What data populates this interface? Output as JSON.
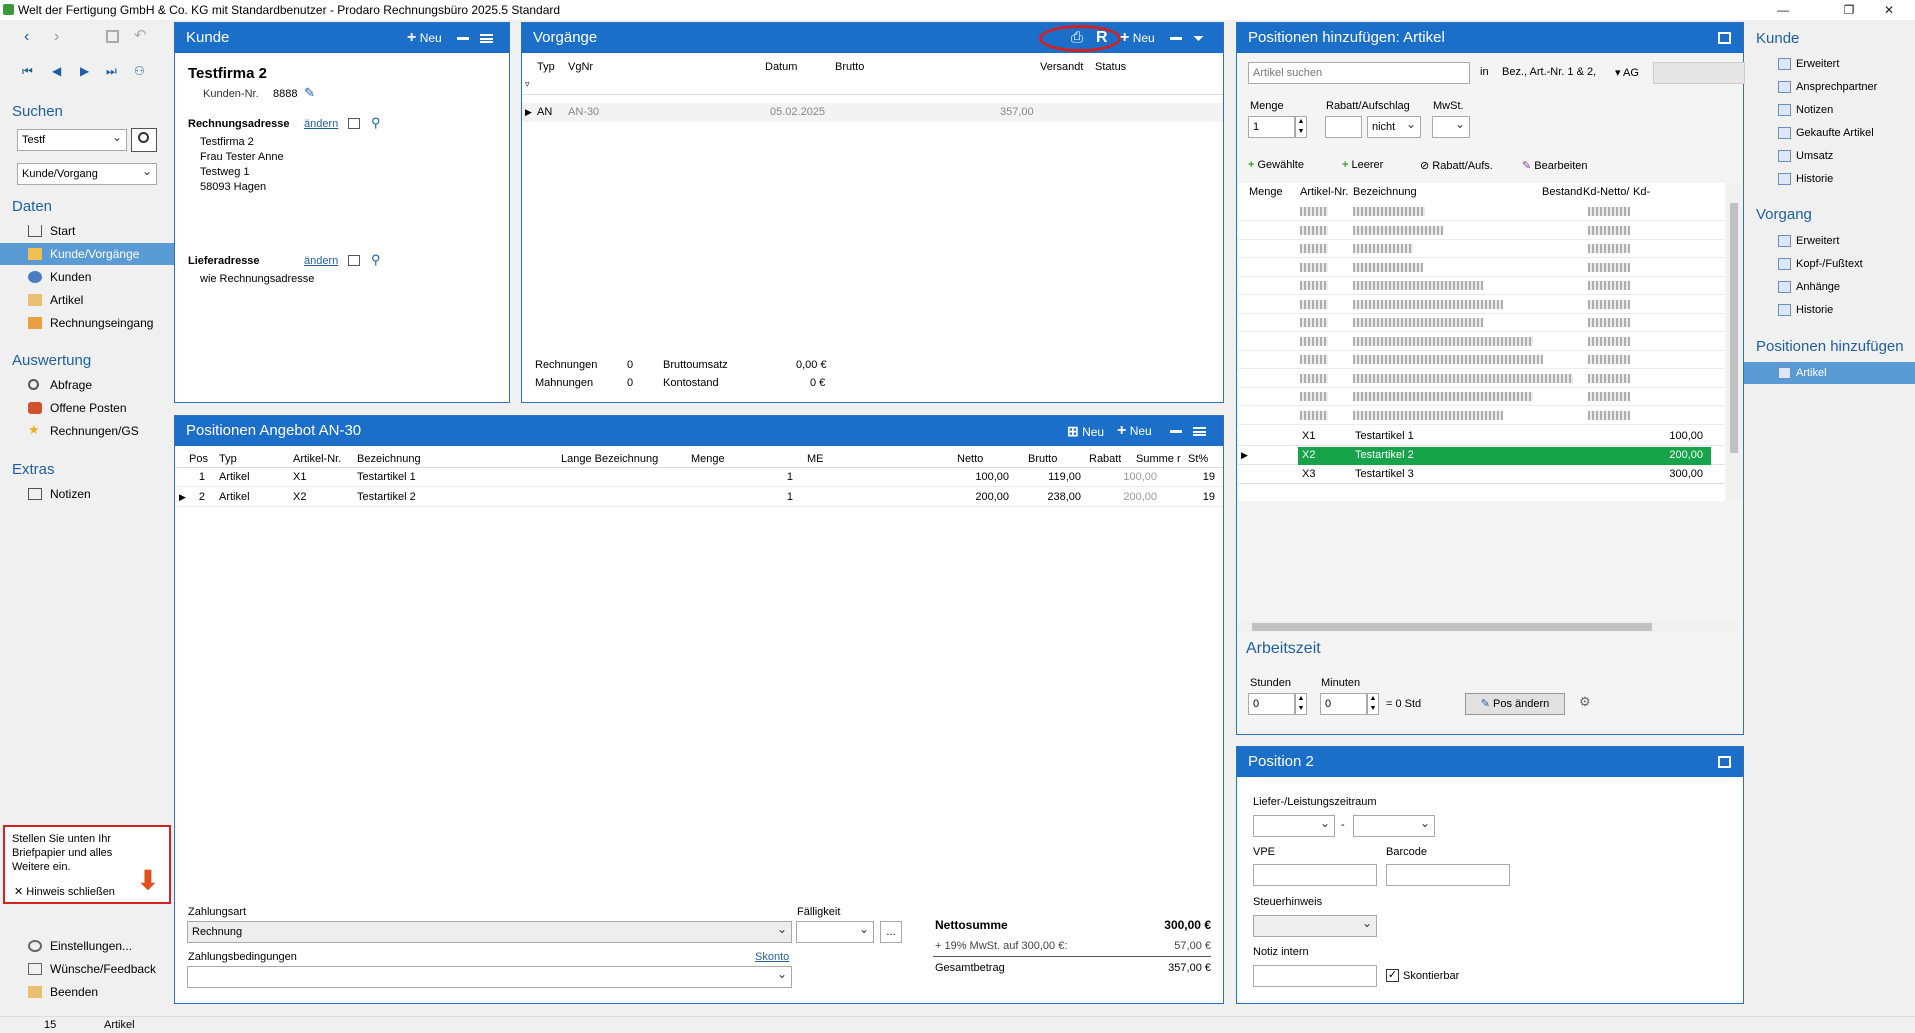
{
  "window": {
    "title": "Welt der Fertigung GmbH & Co. KG mit Standardbenutzer  -  Prodaro Rechnungsbüro 2025.5 Standard"
  },
  "left": {
    "suchen_label": "Suchen",
    "search_value": "Testf",
    "scope_value": "Kunde/Vorgang",
    "daten_label": "Daten",
    "daten": [
      "Start",
      "Kunde/Vorgänge",
      "Kunden",
      "Artikel",
      "Rechnungseingang"
    ],
    "auswertung_label": "Auswertung",
    "auswertung": [
      "Abfrage",
      "Offene Posten",
      "Rechnungen/GS"
    ],
    "extras_label": "Extras",
    "extras": [
      "Notizen"
    ],
    "hint_text": "Stellen Sie unten Ihr Briefpapier und alles Weitere ein.",
    "hint_close": "Hinweis schließen",
    "bottom": [
      "Einstellungen...",
      "Wünsche/Feedback",
      "Beenden"
    ]
  },
  "kunde": {
    "title": "Kunde",
    "neu": "Neu",
    "name": "Testfirma 2",
    "nr_label": "Kunden-Nr.",
    "nr": "8888",
    "rechnungsadresse_label": "Rechnungsadresse",
    "aendern": "ändern",
    "address": [
      "Testfirma 2",
      "Frau Tester Anne",
      "Testweg 1",
      "58093 Hagen"
    ],
    "lieferadresse_label": "Lieferadresse",
    "liefer_value": "wie Rechnungsadresse"
  },
  "vorgaenge": {
    "title": "Vorgänge",
    "r_label": "R",
    "neu": "Neu",
    "columns": [
      "Typ",
      "VgNr",
      "Datum",
      "Brutto",
      "Versandt",
      "Status"
    ],
    "rows": [
      {
        "typ": "AN",
        "nr": "AN-30",
        "datum": "05.02.2025",
        "brutto": "357,00"
      }
    ],
    "rechnungen_label": "Rechnungen",
    "rechnungen": "0",
    "mahnungen_label": "Mahnungen",
    "mahnungen": "0",
    "bruttoumsatz_label": "Bruttoumsatz",
    "bruttoumsatz": "0,00 €",
    "kontostand_label": "Kontostand",
    "kontostand": "0 €"
  },
  "positionen": {
    "title": "Positionen Angebot AN-30",
    "neu1": "Neu",
    "neu2": "Neu",
    "columns": [
      "Pos",
      "Typ",
      "Artikel-Nr.",
      "Bezeichnung",
      "Lange Bezeichnung",
      "Menge",
      "ME",
      "Netto",
      "Brutto",
      "Rabatt",
      "Summe r",
      "St%"
    ],
    "rows": [
      {
        "pos": "1",
        "typ": "Artikel",
        "nr": "X1",
        "bez": "Testartikel 1",
        "menge": "1",
        "netto": "100,00",
        "brutto": "119,00",
        "summe": "100,00",
        "st": "19"
      },
      {
        "pos": "2",
        "typ": "Artikel",
        "nr": "X2",
        "bez": "Testartikel 2",
        "menge": "1",
        "netto": "200,00",
        "brutto": "238,00",
        "summe": "200,00",
        "st": "19"
      }
    ],
    "zahlungsart_label": "Zahlungsart",
    "zahlungsart": "Rechnung",
    "faelligkeit_label": "Fälligkeit",
    "zahlungsbedingungen_label": "Zahlungsbedingungen",
    "skonto": "Skonto",
    "nettosumme_label": "Nettosumme",
    "nettosumme": "300,00  €",
    "mwst_label": "+ 19% MwSt. auf 300,00 €:",
    "mwst": "57,00  €",
    "gesamt_label": "Gesamtbetrag",
    "gesamt": "357,00  €"
  },
  "artikel": {
    "title": "Positionen hinzufügen: Artikel",
    "search_placeholder": "Artikel suchen",
    "in_label": "in",
    "in_value": "Bez., Art.-Nr. 1 & 2,",
    "ag": "AG",
    "menge_label": "Menge",
    "menge": "1",
    "rabatt_label": "Rabatt/Aufschlag",
    "rabatt_mode": "nicht",
    "mwst_label": "MwSt.",
    "actions": [
      "Gewählte",
      "Leerer",
      "Rabatt/Aufs.",
      "Bearbeiten"
    ],
    "columns": [
      "Menge",
      "Artikel-Nr.",
      "Bezeichnung",
      "Bestand",
      "Kd-Netto/",
      "Kd-"
    ],
    "rows": [
      {
        "nr": "X1",
        "bez": "Testartikel 1",
        "netto": "100,00"
      },
      {
        "nr": "X2",
        "bez": "Testartikel 2",
        "netto": "200,00"
      },
      {
        "nr": "X3",
        "bez": "Testartikel 3",
        "netto": "300,00"
      }
    ],
    "arbeitszeit_label": "Arbeitszeit",
    "stunden_label": "Stunden",
    "stunden": "0",
    "minuten_label": "Minuten",
    "minuten": "0",
    "std_text": "= 0 Std",
    "pos_aendern": "Pos ändern"
  },
  "position2": {
    "title": "Position 2",
    "liefer_label": "Liefer-/Leistungszeitraum",
    "dash": "-",
    "vpe_label": "VPE",
    "barcode_label": "Barcode",
    "steuer_label": "Steuerhinweis",
    "notiz_label": "Notiz intern",
    "skontierbar": "Skontierbar"
  },
  "right": {
    "kunde_label": "Kunde",
    "kunde": [
      "Erweitert",
      "Ansprechpartner",
      "Notizen",
      "Gekaufte Artikel",
      "Umsatz",
      "Historie"
    ],
    "vorgang_label": "Vorgang",
    "vorgang": [
      "Erweitert",
      "Kopf-/Fußtext",
      "Anhänge",
      "Historie"
    ],
    "pos_label": "Positionen hinzufügen",
    "pos": [
      "Artikel"
    ]
  },
  "status": {
    "count": "15",
    "context": "Artikel"
  },
  "colors": {
    "header": "#1b6fc9",
    "highlight": "#16a34a",
    "accent": "#1f5f9f",
    "circle": "#d42020"
  }
}
